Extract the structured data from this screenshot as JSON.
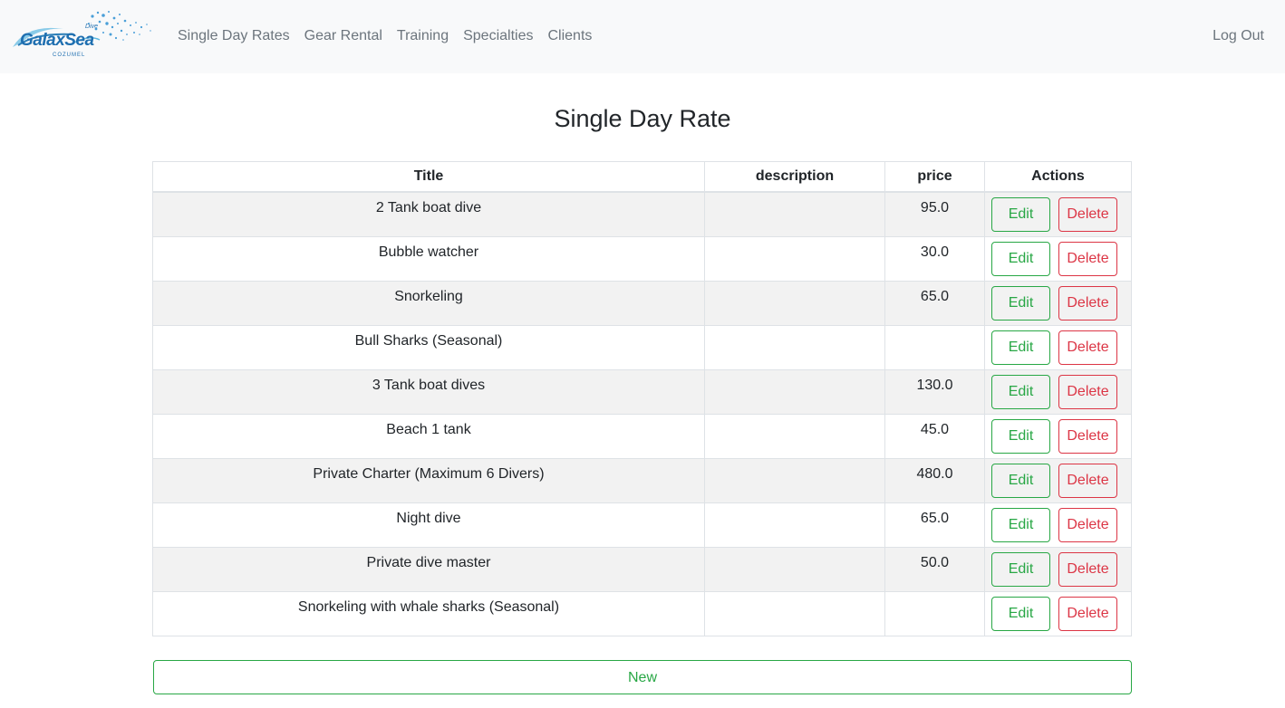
{
  "brand": {
    "name": "GalaxSea",
    "sub_top": "Dive",
    "sub_bottom": "COZUMEL"
  },
  "nav": {
    "links": [
      "Single Day Rates",
      "Gear Rental",
      "Training",
      "Specialties",
      "Clients"
    ],
    "logout": "Log Out"
  },
  "page": {
    "title": "Single Day Rate"
  },
  "table": {
    "headers": [
      "Title",
      "description",
      "price",
      "Actions"
    ],
    "rows": [
      {
        "title": "2 Tank boat dive",
        "description": "",
        "price": "95.0"
      },
      {
        "title": "Bubble watcher",
        "description": "",
        "price": "30.0"
      },
      {
        "title": "Snorkeling",
        "description": "",
        "price": "65.0"
      },
      {
        "title": "Bull Sharks (Seasonal)",
        "description": "",
        "price": ""
      },
      {
        "title": "3 Tank boat dives",
        "description": "",
        "price": "130.0"
      },
      {
        "title": "Beach 1 tank",
        "description": "",
        "price": "45.0"
      },
      {
        "title": "Private Charter (Maximum 6 Divers)",
        "description": "",
        "price": "480.0"
      },
      {
        "title": "Night dive",
        "description": "",
        "price": "65.0"
      },
      {
        "title": "Private dive master",
        "description": "",
        "price": "50.0"
      },
      {
        "title": "Snorkeling with whale sharks (Seasonal)",
        "description": "",
        "price": ""
      }
    ],
    "edit_label": "Edit",
    "delete_label": "Delete"
  },
  "new_button": "New",
  "colors": {
    "success": "#28a745",
    "danger": "#dc3545",
    "nav_text": "#6c757d",
    "navbar_bg": "#f8f9fa"
  }
}
